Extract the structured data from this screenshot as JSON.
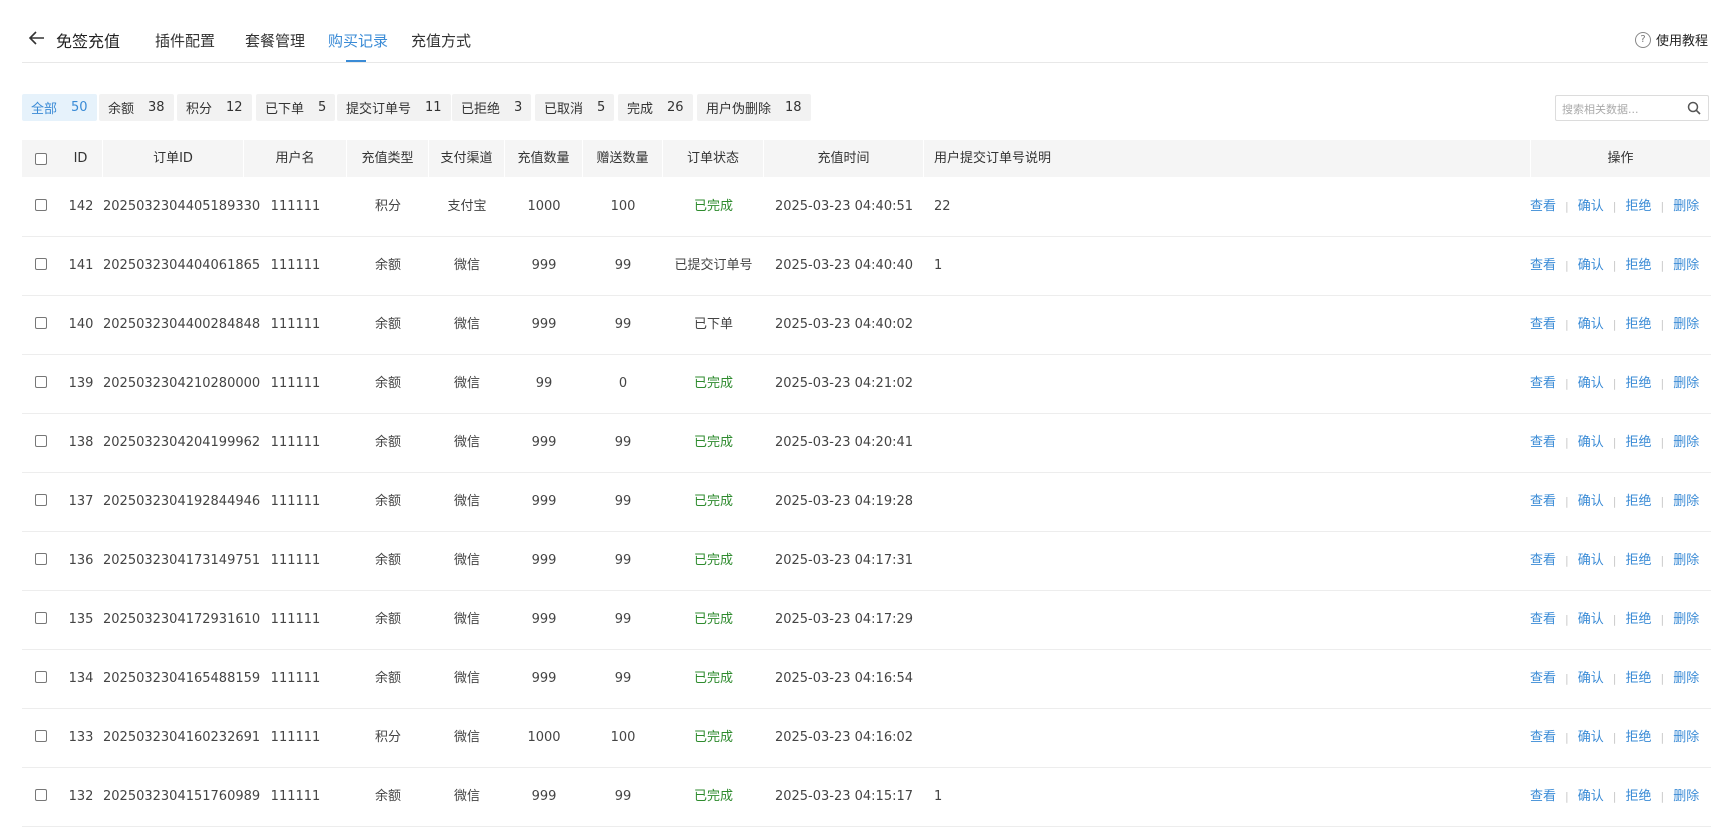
{
  "header": {
    "title": "免签充值",
    "tabs": [
      {
        "label": "插件配置"
      },
      {
        "label": "套餐管理"
      },
      {
        "label": "购买记录"
      },
      {
        "label": "充值方式"
      }
    ],
    "active_tab": 2,
    "help_label": "使用教程"
  },
  "filters": [
    {
      "label": "全部",
      "count": "50",
      "active": true
    },
    {
      "label": "余额",
      "count": "38"
    },
    {
      "label": "积分",
      "count": "12"
    },
    {
      "label": "已下单",
      "count": "5"
    },
    {
      "label": "提交订单号",
      "count": "11"
    },
    {
      "label": "已拒绝",
      "count": "3"
    },
    {
      "label": "已取消",
      "count": "5"
    },
    {
      "label": "完成",
      "count": "26"
    },
    {
      "label": "用户伪删除",
      "count": "18"
    }
  ],
  "search": {
    "placeholder": "搜索相关数据..."
  },
  "table": {
    "columns": [
      "ID",
      "订单ID",
      "用户名",
      "充值类型",
      "支付渠道",
      "充值数量",
      "赠送数量",
      "订单状态",
      "充值时间",
      "用户提交订单号说明",
      "操作"
    ],
    "actions": [
      "查看",
      "确认",
      "拒绝",
      "删除"
    ],
    "rows": [
      {
        "id": "142",
        "order_id": "2025032304405189330",
        "user": "111111",
        "type": "积分",
        "channel": "支付宝",
        "amount": "1000",
        "bonus": "100",
        "status": "已完成",
        "done": true,
        "time": "2025-03-23 04:40:51",
        "note": "22"
      },
      {
        "id": "141",
        "order_id": "2025032304404061865",
        "user": "111111",
        "type": "余额",
        "channel": "微信",
        "amount": "999",
        "bonus": "99",
        "status": "已提交订单号",
        "done": false,
        "time": "2025-03-23 04:40:40",
        "note": "1"
      },
      {
        "id": "140",
        "order_id": "2025032304400284848",
        "user": "111111",
        "type": "余额",
        "channel": "微信",
        "amount": "999",
        "bonus": "99",
        "status": "已下单",
        "done": false,
        "time": "2025-03-23 04:40:02",
        "note": ""
      },
      {
        "id": "139",
        "order_id": "2025032304210280000",
        "user": "111111",
        "type": "余额",
        "channel": "微信",
        "amount": "99",
        "bonus": "0",
        "status": "已完成",
        "done": true,
        "time": "2025-03-23 04:21:02",
        "note": ""
      },
      {
        "id": "138",
        "order_id": "2025032304204199962",
        "user": "111111",
        "type": "余额",
        "channel": "微信",
        "amount": "999",
        "bonus": "99",
        "status": "已完成",
        "done": true,
        "time": "2025-03-23 04:20:41",
        "note": ""
      },
      {
        "id": "137",
        "order_id": "2025032304192844946",
        "user": "111111",
        "type": "余额",
        "channel": "微信",
        "amount": "999",
        "bonus": "99",
        "status": "已完成",
        "done": true,
        "time": "2025-03-23 04:19:28",
        "note": ""
      },
      {
        "id": "136",
        "order_id": "2025032304173149751",
        "user": "111111",
        "type": "余额",
        "channel": "微信",
        "amount": "999",
        "bonus": "99",
        "status": "已完成",
        "done": true,
        "time": "2025-03-23 04:17:31",
        "note": ""
      },
      {
        "id": "135",
        "order_id": "2025032304172931610",
        "user": "111111",
        "type": "余额",
        "channel": "微信",
        "amount": "999",
        "bonus": "99",
        "status": "已完成",
        "done": true,
        "time": "2025-03-23 04:17:29",
        "note": ""
      },
      {
        "id": "134",
        "order_id": "2025032304165488159",
        "user": "111111",
        "type": "余额",
        "channel": "微信",
        "amount": "999",
        "bonus": "99",
        "status": "已完成",
        "done": true,
        "time": "2025-03-23 04:16:54",
        "note": ""
      },
      {
        "id": "133",
        "order_id": "2025032304160232691",
        "user": "111111",
        "type": "积分",
        "channel": "微信",
        "amount": "1000",
        "bonus": "100",
        "status": "已完成",
        "done": true,
        "time": "2025-03-23 04:16:02",
        "note": ""
      },
      {
        "id": "132",
        "order_id": "2025032304151760989",
        "user": "111111",
        "type": "余额",
        "channel": "微信",
        "amount": "999",
        "bonus": "99",
        "status": "已完成",
        "done": true,
        "time": "2025-03-23 04:15:17",
        "note": "1"
      }
    ]
  },
  "colors": {
    "accent": "#3a8bd6",
    "done": "#2e8b2e"
  },
  "icons": {
    "back": "arrow-left-icon",
    "help": "question-circle-icon",
    "search": "search-icon"
  }
}
